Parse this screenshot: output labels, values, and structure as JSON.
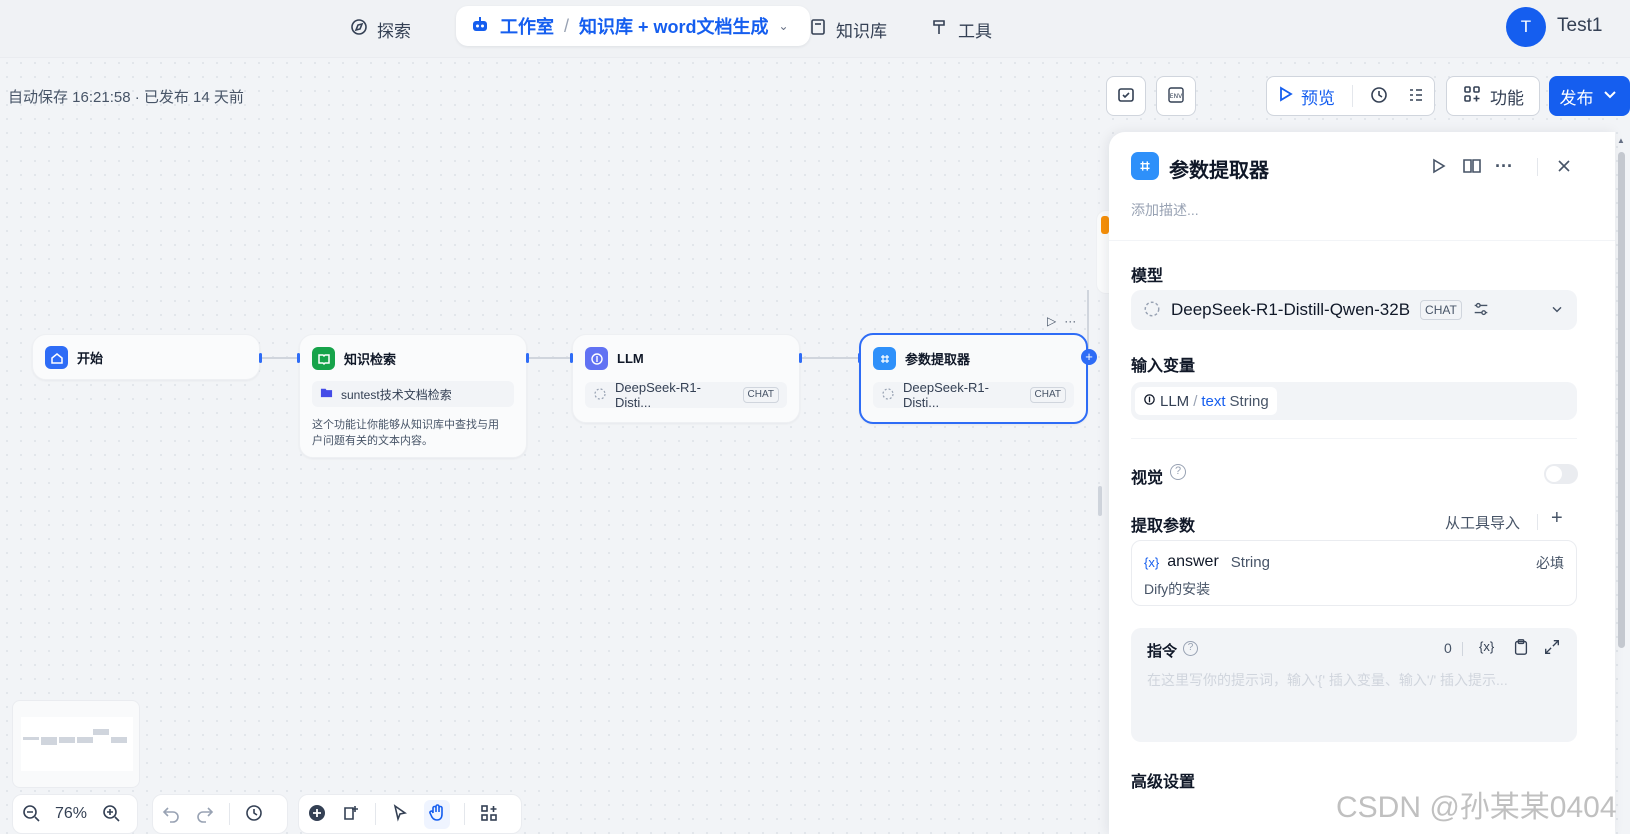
{
  "nav": {
    "explore": "探索",
    "studio": "工作室",
    "app_name": "知识库 + word文档生成",
    "knowledge": "知识库",
    "tools": "工具",
    "user_initial": "T",
    "user_name": "Test1"
  },
  "toolbar": {
    "autosave": "自动保存 16:21:58 · 已发布 14 天前",
    "preview": "预览",
    "features": "功能",
    "publish": "发布"
  },
  "nodes": {
    "start": {
      "title": "开始"
    },
    "knowledge": {
      "title": "知识检索",
      "dataset": "suntest技术文档检索",
      "description_l1": "这个功能让你能够从知识库中查找与用",
      "description_l2": "户问题有关的文本内容。"
    },
    "llm": {
      "title": "LLM",
      "model": "DeepSeek-R1-Disti...",
      "tag": "CHAT"
    },
    "extractor": {
      "title": "参数提取器",
      "model": "DeepSeek-R1-Disti...",
      "tag": "CHAT"
    }
  },
  "panel": {
    "title": "参数提取器",
    "description_placeholder": "添加描述...",
    "model_label": "模型",
    "model_name": "DeepSeek-R1-Distill-Qwen-32B",
    "model_tag": "CHAT",
    "input_label": "输入变量",
    "input_node": "LLM",
    "input_var": "text",
    "input_type": "String",
    "vision_label": "视觉",
    "vision_enabled": false,
    "extract_label": "提取参数",
    "import_from_tool": "从工具导入",
    "param": {
      "var_badge": "{x}",
      "name": "answer",
      "type": "String",
      "required": "必填",
      "description": "Dify的安装"
    },
    "instruction_label": "指令",
    "instruction_count": "0",
    "instruction_placeholder": "在这里写你的提示词，输入'{' 插入变量、输入'/' 插入提示...",
    "advanced_label": "高级设置"
  },
  "bottom": {
    "zoom": "76%"
  },
  "watermark": "CSDN @孙某某0404",
  "colors": {
    "accent": "#155eef",
    "start_icon": "#2e6cf6",
    "knowledge_icon": "#16a34a",
    "llm_icon": "#6172f3",
    "extractor_icon": "#2e90fa"
  }
}
